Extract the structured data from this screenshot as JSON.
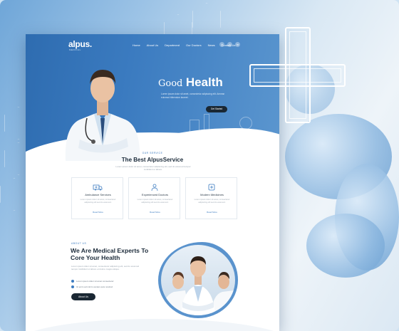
{
  "logo": {
    "name": "alpus.",
    "tagline": "MEDICAL"
  },
  "nav": {
    "items": [
      "Home",
      "About Us",
      "Department",
      "Our Doctors",
      "News",
      "Contact Us"
    ]
  },
  "socials": [
    {
      "icon": "facebook-icon",
      "glyph": "f"
    },
    {
      "icon": "twitter-icon",
      "glyph": "t"
    },
    {
      "icon": "linkedin-icon",
      "glyph": "in"
    }
  ],
  "hero": {
    "title_light": "Good",
    "title_bold": "Health",
    "text": "Lorem ipsum dolor sit amet, consectetur adipiscing elit. Aenean euismod bibendum laoreet.",
    "button": "Get Started"
  },
  "services": {
    "kicker": "OUR SERVICE",
    "title": "The Best AlpusService",
    "text": "Lorem ipsum dolor sit amet, consectetur adipiscing elit, sed do eiusmod tempor incididunt ut labore.",
    "cards": [
      {
        "icon": "ambulance-icon",
        "title": "Ambulance Services",
        "text": "Lorem ipsum dolor sit amet, consectetur adipiscing elit sed do eiusmod.",
        "link": "Read More"
      },
      {
        "icon": "doctor-icon",
        "title": "Experienced Doctors",
        "text": "Lorem ipsum dolor sit amet, consectetur adipiscing elit sed do eiusmod.",
        "link": "Read More"
      },
      {
        "icon": "medicine-icon",
        "title": "Modern Medicines",
        "text": "Lorem ipsum dolor sit amet, consectetur adipiscing elit sed do eiusmod.",
        "link": "Read More"
      }
    ]
  },
  "about": {
    "kicker": "ABOUT US",
    "title": "We Are Medical Experts To Core Your Health",
    "text": "Lorem ipsum dolor sit amet, consectetur adipiscing elit, sed do eiusmod tempor incididunt ut labore et dolore magna aliqua.",
    "checks": [
      "Lorem ipsum dolor sit amet consectetur",
      "Ut enim ad minim veniam quis nostrud"
    ],
    "button": "About Us"
  },
  "colors": {
    "primary": "#3b7bc0",
    "dark": "#1a2733",
    "heading": "#1c2b3a"
  }
}
